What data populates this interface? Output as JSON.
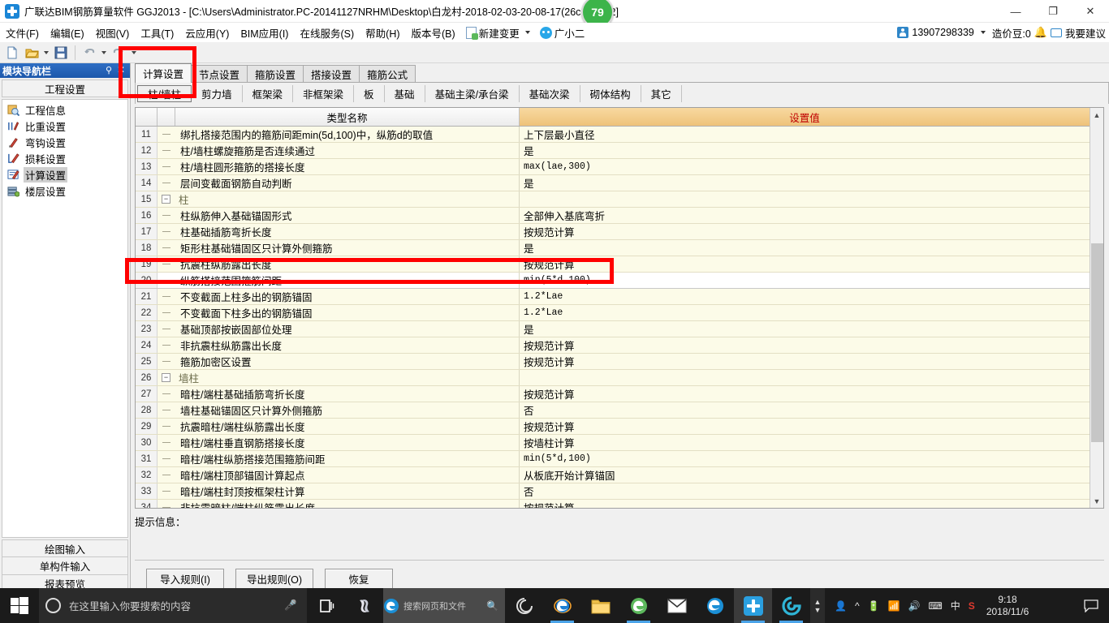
{
  "window": {
    "title": "广联达BIM钢筋算量软件 GGJ2013 - [C:\\Users\\Administrator.PC-20141127NRHM\\Desktop\\白龙村-2018-02-03-20-08-17(26c   GGJ12]",
    "badge": "79",
    "minimize": "—",
    "maximize": "❐",
    "close": "✕"
  },
  "menu": {
    "items": [
      "文件(F)",
      "编辑(E)",
      "视图(V)",
      "工具(T)",
      "云应用(Y)",
      "BIM应用(I)",
      "在线服务(S)",
      "帮助(H)",
      "版本号(B)"
    ],
    "new_change": "新建变更",
    "assistant": "广小二",
    "account": "13907298339",
    "beans": "造价豆:0",
    "suggest": "我要建议"
  },
  "toolbar": {
    "new_icon": "new-file-icon",
    "open_icon": "open-folder-icon",
    "save_icon": "save-icon",
    "undo_icon": "undo-icon",
    "redo_icon": "redo-icon"
  },
  "sidebar": {
    "caption": "模块导航栏",
    "pin": "⚲",
    "close": "✕",
    "group": "工程设置",
    "items": [
      {
        "label": "工程信息",
        "icon": "project-info-icon",
        "selected": false
      },
      {
        "label": "比重设置",
        "icon": "weight-settings-icon",
        "selected": false
      },
      {
        "label": "弯钩设置",
        "icon": "hook-settings-icon",
        "selected": false
      },
      {
        "label": "损耗设置",
        "icon": "loss-settings-icon",
        "selected": false
      },
      {
        "label": "计算设置",
        "icon": "calc-settings-icon",
        "selected": true
      },
      {
        "label": "楼层设置",
        "icon": "floor-settings-icon",
        "selected": false
      }
    ],
    "buttons": [
      "绘图输入",
      "单构件输入",
      "报表预览"
    ]
  },
  "tabs_primary": [
    {
      "label": "计算设置",
      "active": true
    },
    {
      "label": "节点设置",
      "active": false
    },
    {
      "label": "箍筋设置",
      "active": false
    },
    {
      "label": "搭接设置",
      "active": false
    },
    {
      "label": "箍筋公式",
      "active": false
    }
  ],
  "tabs_secondary": [
    {
      "label": "柱/墙柱",
      "active": true
    },
    {
      "label": "剪力墙",
      "active": false
    },
    {
      "label": "框架梁",
      "active": false
    },
    {
      "label": "非框架梁",
      "active": false
    },
    {
      "label": "板",
      "active": false
    },
    {
      "label": "基础",
      "active": false
    },
    {
      "label": "基础主梁/承台梁",
      "active": false
    },
    {
      "label": "基础次梁",
      "active": false
    },
    {
      "label": "砌体结构",
      "active": false
    },
    {
      "label": "其它",
      "active": false
    }
  ],
  "grid": {
    "headers": {
      "name": "类型名称",
      "value": "设置值"
    },
    "rows": [
      {
        "n": "11",
        "kind": "leaf",
        "name": "绑扎搭接范围内的箍筋间距min(5d,100)中，纵筋d的取值",
        "value": "上下层最小直径",
        "mono": false,
        "selected": false
      },
      {
        "n": "12",
        "kind": "leaf",
        "name": "柱/墙柱螺旋箍筋是否连续通过",
        "value": "是",
        "mono": false,
        "selected": false
      },
      {
        "n": "13",
        "kind": "leaf",
        "name": "柱/墙柱圆形箍筋的搭接长度",
        "value": "max(lae,300)",
        "mono": true,
        "selected": false
      },
      {
        "n": "14",
        "kind": "leaf",
        "name": "层间变截面钢筋自动判断",
        "value": "是",
        "mono": false,
        "selected": false
      },
      {
        "n": "15",
        "kind": "group",
        "name": "柱",
        "value": "",
        "mono": false,
        "selected": false
      },
      {
        "n": "16",
        "kind": "leaf",
        "name": "柱纵筋伸入基础锚固形式",
        "value": "全部伸入基底弯折",
        "mono": false,
        "selected": false
      },
      {
        "n": "17",
        "kind": "leaf",
        "name": "柱基础插筋弯折长度",
        "value": "按规范计算",
        "mono": false,
        "selected": false
      },
      {
        "n": "18",
        "kind": "leaf",
        "name": "矩形柱基础锚固区只计算外侧箍筋",
        "value": "是",
        "mono": false,
        "selected": false
      },
      {
        "n": "19",
        "kind": "leaf",
        "name": "抗震柱纵筋露出长度",
        "value": "按规范计算",
        "mono": false,
        "selected": false
      },
      {
        "n": "20",
        "kind": "leaf",
        "name": "纵筋搭接范围箍筋间距",
        "value": "min(5*d,100)",
        "mono": true,
        "selected": true
      },
      {
        "n": "21",
        "kind": "leaf",
        "name": "不变截面上柱多出的钢筋锚固",
        "value": "1.2*Lae",
        "mono": true,
        "selected": false
      },
      {
        "n": "22",
        "kind": "leaf",
        "name": "不变截面下柱多出的钢筋锚固",
        "value": "1.2*Lae",
        "mono": true,
        "selected": false
      },
      {
        "n": "23",
        "kind": "leaf",
        "name": "基础顶部按嵌固部位处理",
        "value": "是",
        "mono": false,
        "selected": false
      },
      {
        "n": "24",
        "kind": "leaf",
        "name": "非抗震柱纵筋露出长度",
        "value": "按规范计算",
        "mono": false,
        "selected": false
      },
      {
        "n": "25",
        "kind": "leaf",
        "name": "箍筋加密区设置",
        "value": "按规范计算",
        "mono": false,
        "selected": false
      },
      {
        "n": "26",
        "kind": "group",
        "name": "墙柱",
        "value": "",
        "mono": false,
        "selected": false
      },
      {
        "n": "27",
        "kind": "leaf",
        "name": "暗柱/端柱基础插筋弯折长度",
        "value": "按规范计算",
        "mono": false,
        "selected": false
      },
      {
        "n": "28",
        "kind": "leaf",
        "name": "墙柱基础锚固区只计算外侧箍筋",
        "value": "否",
        "mono": false,
        "selected": false
      },
      {
        "n": "29",
        "kind": "leaf",
        "name": "抗震暗柱/端柱纵筋露出长度",
        "value": "按规范计算",
        "mono": false,
        "selected": false
      },
      {
        "n": "30",
        "kind": "leaf",
        "name": "暗柱/端柱垂直钢筋搭接长度",
        "value": "按墙柱计算",
        "mono": false,
        "selected": false
      },
      {
        "n": "31",
        "kind": "leaf",
        "name": "暗柱/端柱纵筋搭接范围箍筋间距",
        "value": "min(5*d,100)",
        "mono": true,
        "selected": false
      },
      {
        "n": "32",
        "kind": "leaf",
        "name": "暗柱/端柱顶部锚固计算起点",
        "value": "从板底开始计算锚固",
        "mono": false,
        "selected": false
      },
      {
        "n": "33",
        "kind": "leaf",
        "name": "暗柱/端柱封顶按框架柱计算",
        "value": "否",
        "mono": false,
        "selected": false
      },
      {
        "n": "34",
        "kind": "leaf",
        "name": "非抗震暗柱/端柱纵筋露出长度",
        "value": "按规范计算",
        "mono": false,
        "selected": false
      }
    ],
    "expander_collapse": "−"
  },
  "hint": {
    "label": "提示信息：",
    "text": ""
  },
  "footer_buttons": [
    "导入规则(I)",
    "导出规则(O)",
    "恢复"
  ],
  "taskbar": {
    "search_placeholder": "在这里输入你要搜索的内容",
    "edge_search_placeholder": "搜索网页和文件",
    "time": "9:18",
    "date": "2018/11/6",
    "ime": "中",
    "apps": [
      {
        "name": "task-view-icon"
      },
      {
        "name": "app-blue-swirl-icon"
      },
      {
        "name": "edge-search-box"
      },
      {
        "name": "app-spiral-icon"
      },
      {
        "name": "internet-explorer-icon"
      },
      {
        "name": "file-explorer-icon"
      },
      {
        "name": "green-browser-icon"
      },
      {
        "name": "mail-icon"
      },
      {
        "name": "edge-icon"
      },
      {
        "name": "glodon-app-icon"
      },
      {
        "name": "app-circle-g-icon"
      }
    ]
  },
  "colors": {
    "accent": "#1c57ab",
    "header_value_bg": "#eec27a",
    "header_value_text": "#c00000",
    "row_bg": "#fcfbe8",
    "annotation": "#ff0000",
    "badge_green": "#3cb44a"
  }
}
